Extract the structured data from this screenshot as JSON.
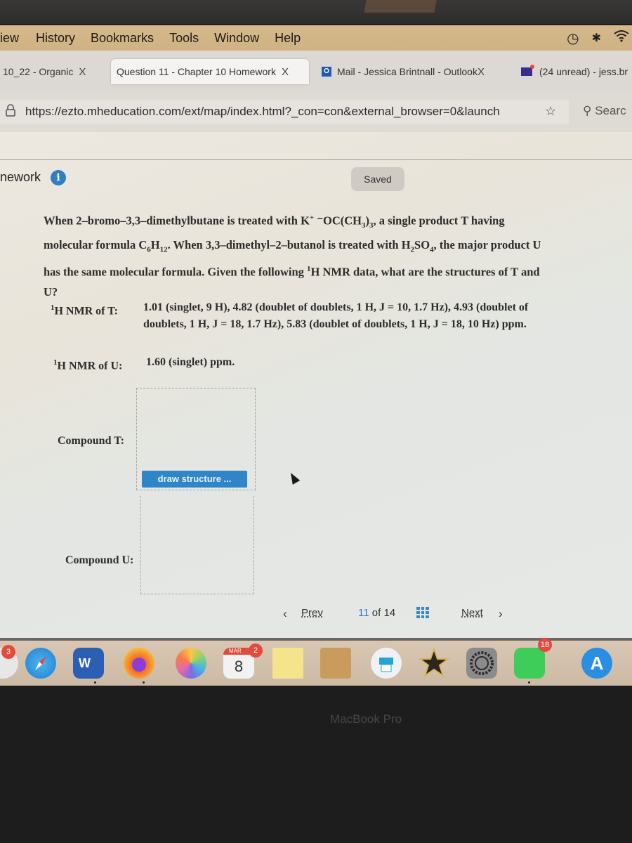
{
  "menubar": {
    "items": [
      "iew",
      "History",
      "Bookmarks",
      "Tools",
      "Window",
      "Help"
    ],
    "status_icons": [
      "time-machine-icon",
      "bluetooth-icon",
      "wifi-icon"
    ]
  },
  "tabs": [
    {
      "label": "10_22 - Organic",
      "close": "X",
      "active": false
    },
    {
      "label": "Question 11 - Chapter 10 Homework",
      "close": "X",
      "active": true
    },
    {
      "label": "Mail - Jessica Brintnall - Outlook",
      "close": "X",
      "active": false,
      "icon": "outlook-icon"
    },
    {
      "label": "(24 unread) - jess.br",
      "active": false,
      "icon": "mail-icon"
    }
  ],
  "urlbar": {
    "url": "https://ezto.mheducation.com/ext/map/index.html?_con=con&external_browser=0&launch",
    "search_placeholder": "Searc"
  },
  "page": {
    "header_label": "nework",
    "saved_label": "Saved",
    "question": {
      "line1_a": "When 2–bromo–3,3–dimethylbutane is treated with K",
      "line1_sup": "+",
      "line1_b": " ⁻OC(CH",
      "line1_sub": "3",
      "line1_c": ")",
      "line1_sub2": "3",
      "line1_d": ", a single product T having",
      "line2_a": "molecular formula C",
      "line2_sub1": "6",
      "line2_b": "H",
      "line2_sub2": "12",
      "line2_c": ". When 3,3–dimethyl–2–butanol is treated with H",
      "line2_sub3": "2",
      "line2_d": "SO",
      "line2_sub4": "4",
      "line2_e": ", the major product U",
      "line3_a": "has the same molecular formula. Given the following ",
      "line3_sup": "1",
      "line3_b": "H NMR data, what are the structures of T and",
      "line4": "U?"
    },
    "nmr_t": {
      "label_sup": "1",
      "label": "H NMR of T:",
      "line1": "1.01 (singlet, 9 H), 4.82 (doublet of doublets, 1 H, J = 10, 1.7 Hz), 4.93 (doublet of",
      "line2": "doublets, 1 H, J = 18, 1.7 Hz), 5.83 (doublet of doublets, 1 H, J = 18, 10 Hz) ppm."
    },
    "nmr_u": {
      "label_sup": "1",
      "label": "H NMR of U:",
      "value": "1.60 (singlet) ppm."
    },
    "compound_t_label": "Compound T:",
    "compound_u_label": "Compound U:",
    "draw_button": "draw structure ...",
    "pager": {
      "prev": "Prev",
      "current": "11",
      "of": "of",
      "total": "14",
      "next": "Next"
    }
  },
  "dock": {
    "apps": [
      "messages",
      "safari",
      "word",
      "firefox",
      "photos",
      "calendar",
      "stickies",
      "notes-folder",
      "printer",
      "imovie",
      "system-preferences",
      "facetime",
      "app-store"
    ],
    "badges": {
      "messages": "3",
      "calendar": "2",
      "facetime": "18"
    },
    "calendar_month": "MAR",
    "calendar_day": "8"
  },
  "bezel_label": "MacBook Pro",
  "colors": {
    "accent": "#2f7fc5",
    "button": "#2e86c8",
    "badge": "#e34b3c"
  }
}
